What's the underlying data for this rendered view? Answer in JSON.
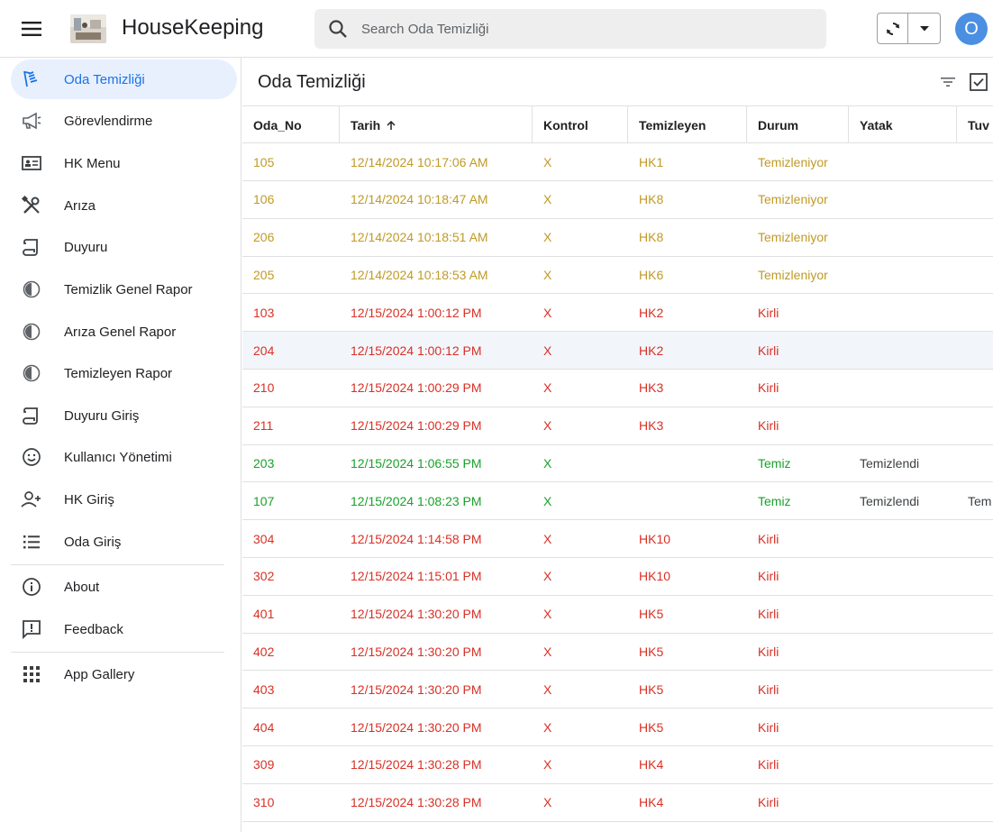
{
  "app": {
    "title": "HouseKeeping",
    "avatar_letter": "O"
  },
  "search": {
    "placeholder": "Search Oda Temizliği"
  },
  "sidebar": {
    "items": [
      {
        "label": "Oda Temizliği",
        "icon": "broom-icon",
        "active": true
      },
      {
        "label": "Görevlendirme",
        "icon": "megaphone-icon"
      },
      {
        "label": "HK Menu",
        "icon": "id-card-icon"
      },
      {
        "label": "Arıza",
        "icon": "tools-icon"
      },
      {
        "label": "Duyuru",
        "icon": "scroll-icon"
      },
      {
        "label": "Temizlik Genel Rapor",
        "icon": "half-circle-icon"
      },
      {
        "label": "Arıza Genel Rapor",
        "icon": "half-circle-icon"
      },
      {
        "label": "Temizleyen Rapor",
        "icon": "half-circle-icon"
      },
      {
        "label": "Duyuru Giriş",
        "icon": "scroll-icon"
      },
      {
        "label": "Kullanıcı Yönetimi",
        "icon": "smiley-icon"
      },
      {
        "label": "HK Giriş",
        "icon": "add-person-icon"
      },
      {
        "label": "Oda Giriş",
        "icon": "list-icon"
      },
      {
        "label": "About",
        "icon": "info-icon"
      },
      {
        "label": "Feedback",
        "icon": "feedback-icon"
      },
      {
        "label": "App Gallery",
        "icon": "grid-icon"
      }
    ]
  },
  "page": {
    "title": "Oda Temizliği"
  },
  "table": {
    "columns": [
      "Oda_No",
      "Tarih",
      "Kontrol",
      "Temizleyen",
      "Durum",
      "Yatak",
      "Tuv"
    ],
    "rows": [
      {
        "oda": "105",
        "tarih": "12/14/2024 10:17:06 AM",
        "kontrol": "X",
        "temizleyen": "HK1",
        "durum": "Temizleniyor",
        "yatak": "",
        "tuv": "",
        "color": "yellow"
      },
      {
        "oda": "106",
        "tarih": "12/14/2024 10:18:47 AM",
        "kontrol": "X",
        "temizleyen": "HK8",
        "durum": "Temizleniyor",
        "yatak": "",
        "tuv": "",
        "color": "yellow"
      },
      {
        "oda": "206",
        "tarih": "12/14/2024 10:18:51 AM",
        "kontrol": "X",
        "temizleyen": "HK8",
        "durum": "Temizleniyor",
        "yatak": "",
        "tuv": "",
        "color": "yellow"
      },
      {
        "oda": "205",
        "tarih": "12/14/2024 10:18:53 AM",
        "kontrol": "X",
        "temizleyen": "HK6",
        "durum": "Temizleniyor",
        "yatak": "",
        "tuv": "",
        "color": "yellow"
      },
      {
        "oda": "103",
        "tarih": "12/15/2024 1:00:12 PM",
        "kontrol": "X",
        "temizleyen": "HK2",
        "durum": "Kirli",
        "yatak": "",
        "tuv": "",
        "color": "red"
      },
      {
        "oda": "204",
        "tarih": "12/15/2024 1:00:12 PM",
        "kontrol": "X",
        "temizleyen": "HK2",
        "durum": "Kirli",
        "yatak": "",
        "tuv": "",
        "color": "red",
        "highlight": true
      },
      {
        "oda": "210",
        "tarih": "12/15/2024 1:00:29 PM",
        "kontrol": "X",
        "temizleyen": "HK3",
        "durum": "Kirli",
        "yatak": "",
        "tuv": "",
        "color": "red"
      },
      {
        "oda": "211",
        "tarih": "12/15/2024 1:00:29 PM",
        "kontrol": "X",
        "temizleyen": "HK3",
        "durum": "Kirli",
        "yatak": "",
        "tuv": "",
        "color": "red"
      },
      {
        "oda": "203",
        "tarih": "12/15/2024 1:06:55 PM",
        "kontrol": "X",
        "temizleyen": "",
        "durum": "Temiz",
        "yatak": "Temizlendi",
        "tuv": "",
        "color": "green"
      },
      {
        "oda": "107",
        "tarih": "12/15/2024 1:08:23 PM",
        "kontrol": "X",
        "temizleyen": "",
        "durum": "Temiz",
        "yatak": "Temizlendi",
        "tuv": "Tem",
        "color": "green"
      },
      {
        "oda": "304",
        "tarih": "12/15/2024 1:14:58 PM",
        "kontrol": "X",
        "temizleyen": "HK10",
        "durum": "Kirli",
        "yatak": "",
        "tuv": "",
        "color": "red"
      },
      {
        "oda": "302",
        "tarih": "12/15/2024 1:15:01 PM",
        "kontrol": "X",
        "temizleyen": "HK10",
        "durum": "Kirli",
        "yatak": "",
        "tuv": "",
        "color": "red"
      },
      {
        "oda": "401",
        "tarih": "12/15/2024 1:30:20 PM",
        "kontrol": "X",
        "temizleyen": "HK5",
        "durum": "Kirli",
        "yatak": "",
        "tuv": "",
        "color": "red"
      },
      {
        "oda": "402",
        "tarih": "12/15/2024 1:30:20 PM",
        "kontrol": "X",
        "temizleyen": "HK5",
        "durum": "Kirli",
        "yatak": "",
        "tuv": "",
        "color": "red"
      },
      {
        "oda": "403",
        "tarih": "12/15/2024 1:30:20 PM",
        "kontrol": "X",
        "temizleyen": "HK5",
        "durum": "Kirli",
        "yatak": "",
        "tuv": "",
        "color": "red"
      },
      {
        "oda": "404",
        "tarih": "12/15/2024 1:30:20 PM",
        "kontrol": "X",
        "temizleyen": "HK5",
        "durum": "Kirli",
        "yatak": "",
        "tuv": "",
        "color": "red"
      },
      {
        "oda": "309",
        "tarih": "12/15/2024 1:30:28 PM",
        "kontrol": "X",
        "temizleyen": "HK4",
        "durum": "Kirli",
        "yatak": "",
        "tuv": "",
        "color": "red"
      },
      {
        "oda": "310",
        "tarih": "12/15/2024 1:30:28 PM",
        "kontrol": "X",
        "temizleyen": "HK4",
        "durum": "Kirli",
        "yatak": "",
        "tuv": "",
        "color": "red"
      }
    ]
  },
  "colors": {
    "accent": "#1a73e8",
    "yellow": "#c09a26",
    "red": "#d93025",
    "green": "#1aa12a",
    "avatar": "#4a8fe2"
  }
}
